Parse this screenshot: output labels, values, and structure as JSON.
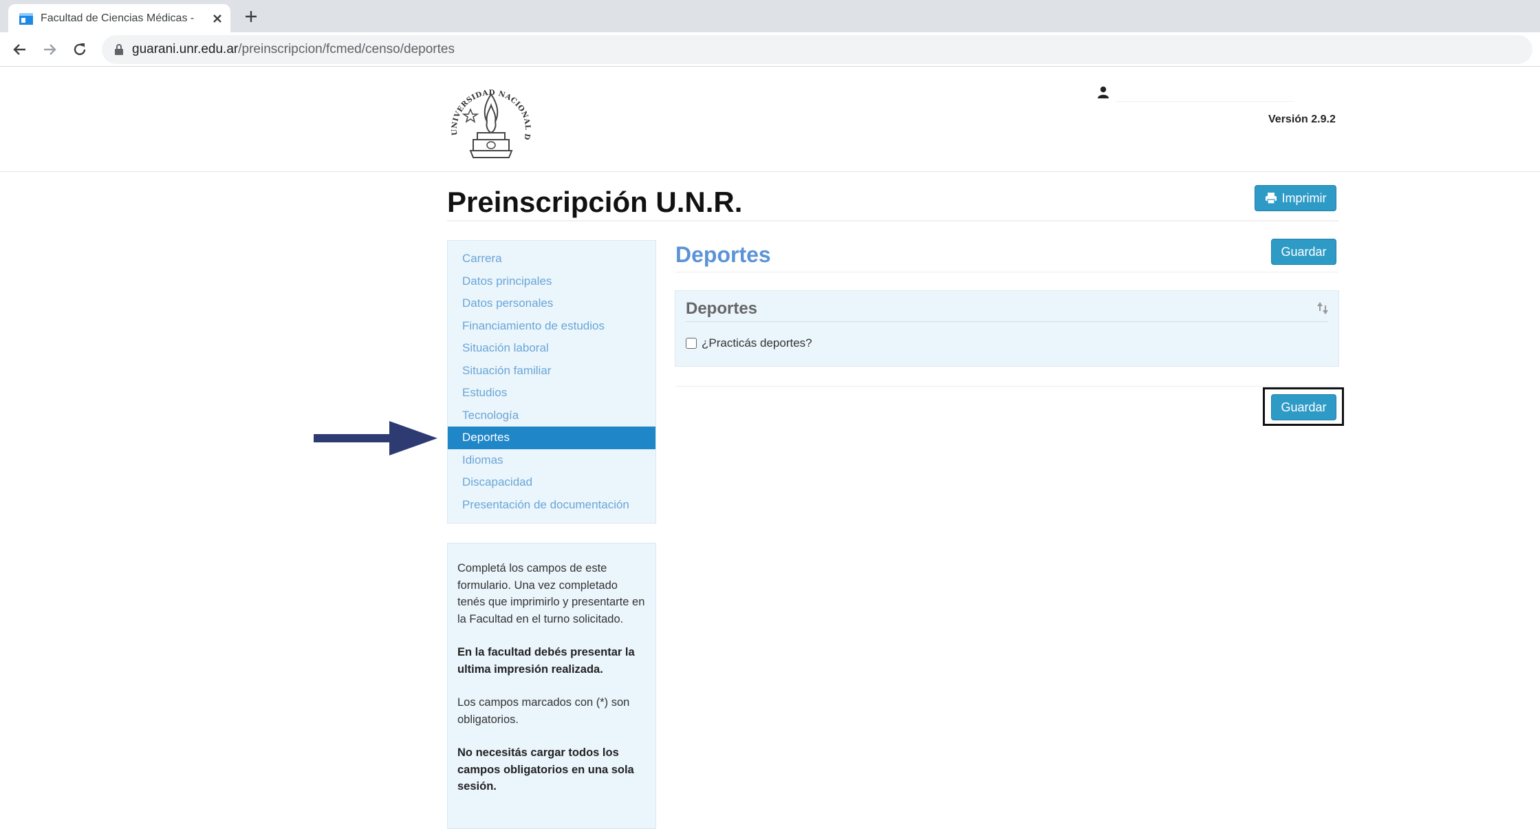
{
  "browser": {
    "tab_title": "Facultad de Ciencias Médicas - E",
    "url_host": "guarani.unr.edu.ar",
    "url_path": "/preinscripcion/fcmed/censo/deportes"
  },
  "header": {
    "logo_text": "UNIVERSIDAD NACIONAL DE ROSARIO",
    "version": "Versión 2.9.2"
  },
  "page": {
    "title": "Preinscripción U.N.R.",
    "print_label": "Imprimir"
  },
  "sidebar": {
    "items": [
      {
        "label": "Carrera"
      },
      {
        "label": "Datos principales"
      },
      {
        "label": "Datos personales"
      },
      {
        "label": "Financiamiento de estudios"
      },
      {
        "label": "Situación laboral"
      },
      {
        "label": "Situación familiar"
      },
      {
        "label": "Estudios"
      },
      {
        "label": "Tecnología"
      },
      {
        "label": "Deportes"
      },
      {
        "label": "Idiomas"
      },
      {
        "label": "Discapacidad"
      },
      {
        "label": "Presentación de documentación"
      }
    ],
    "active": "Deportes"
  },
  "info": {
    "p1": "Completá los campos de este formulario. Una vez completado tenés que imprimirlo y presentarte en la Facultad en el turno solicitado.",
    "p2": "En la facultad debés presentar la ultima impresión realizada.",
    "p3": "Los campos marcados con (*) son obligatorios.",
    "p4": "No necesitás cargar todos los campos obligatorios en una sola sesión."
  },
  "main": {
    "section_title": "Deportes",
    "save_label": "Guardar",
    "panel_title": "Deportes",
    "checkbox_label": "¿Practicás deportes?",
    "checkbox_checked": false
  },
  "colors": {
    "accent": "#2e9ac6",
    "active_nav": "#1f86c8",
    "link": "#6aa6d6",
    "section_title": "#5b93d6",
    "arrow": "#2e3b73"
  }
}
